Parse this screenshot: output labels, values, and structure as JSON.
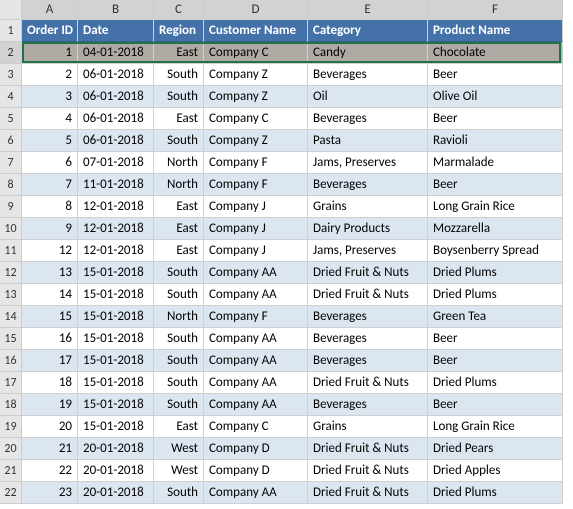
{
  "columns": [
    "A",
    "B",
    "C",
    "D",
    "E",
    "F"
  ],
  "headers": {
    "A": "Order ID",
    "B": "Date",
    "C": "Region",
    "D": "Customer Name",
    "E": "Category",
    "F": "Product Name"
  },
  "selected_row": 2,
  "chart_data": {
    "type": "table",
    "columns": [
      "Order ID",
      "Date",
      "Region",
      "Customer Name",
      "Category",
      "Product Name"
    ],
    "rows": [
      [
        1,
        "04-01-2018",
        "East",
        "Company C",
        "Candy",
        "Chocolate"
      ],
      [
        2,
        "06-01-2018",
        "South",
        "Company Z",
        "Beverages",
        "Beer"
      ],
      [
        3,
        "06-01-2018",
        "South",
        "Company Z",
        "Oil",
        "Olive Oil"
      ],
      [
        4,
        "06-01-2018",
        "East",
        "Company C",
        "Beverages",
        "Beer"
      ],
      [
        5,
        "06-01-2018",
        "South",
        "Company Z",
        "Pasta",
        "Ravioli"
      ],
      [
        6,
        "07-01-2018",
        "North",
        "Company F",
        "Jams, Preserves",
        "Marmalade"
      ],
      [
        7,
        "11-01-2018",
        "North",
        "Company F",
        "Beverages",
        "Beer"
      ],
      [
        8,
        "12-01-2018",
        "East",
        "Company J",
        "Grains",
        "Long Grain Rice"
      ],
      [
        9,
        "12-01-2018",
        "East",
        "Company J",
        "Dairy Products",
        "Mozzarella"
      ],
      [
        12,
        "12-01-2018",
        "East",
        "Company J",
        "Jams, Preserves",
        "Boysenberry Spread"
      ],
      [
        13,
        "15-01-2018",
        "South",
        "Company AA",
        "Dried Fruit & Nuts",
        "Dried Plums"
      ],
      [
        14,
        "15-01-2018",
        "South",
        "Company AA",
        "Dried Fruit & Nuts",
        "Dried Plums"
      ],
      [
        15,
        "15-01-2018",
        "North",
        "Company F",
        "Beverages",
        "Green Tea"
      ],
      [
        16,
        "15-01-2018",
        "South",
        "Company AA",
        "Beverages",
        "Beer"
      ],
      [
        17,
        "15-01-2018",
        "South",
        "Company AA",
        "Beverages",
        "Beer"
      ],
      [
        18,
        "15-01-2018",
        "South",
        "Company AA",
        "Dried Fruit & Nuts",
        "Dried Plums"
      ],
      [
        19,
        "15-01-2018",
        "South",
        "Company AA",
        "Beverages",
        "Beer"
      ],
      [
        20,
        "15-01-2018",
        "East",
        "Company C",
        "Grains",
        "Long Grain Rice"
      ],
      [
        21,
        "20-01-2018",
        "West",
        "Company D",
        "Dried Fruit & Nuts",
        "Dried Pears"
      ],
      [
        22,
        "20-01-2018",
        "West",
        "Company D",
        "Dried Fruit & Nuts",
        "Dried Apples"
      ],
      [
        23,
        "20-01-2018",
        "South",
        "Company AA",
        "Dried Fruit & Nuts",
        "Dried Plums"
      ]
    ]
  }
}
